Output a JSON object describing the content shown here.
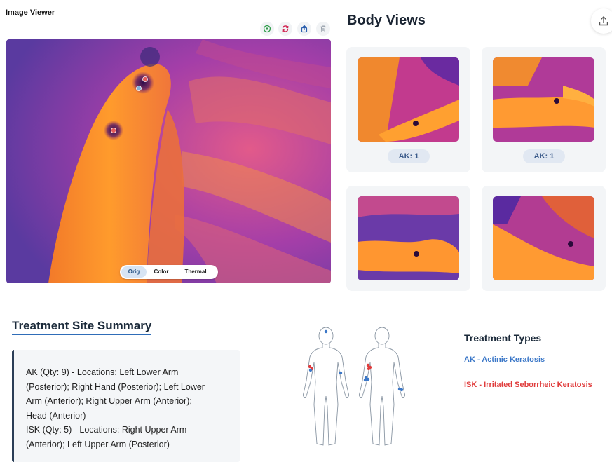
{
  "viewer": {
    "title": "Image Viewer",
    "tools": [
      {
        "icon": "add-circle-icon",
        "color": "#2e9c48"
      },
      {
        "icon": "refresh-icon",
        "color": "#d0204e"
      },
      {
        "icon": "export-icon",
        "color": "#2b5fae"
      },
      {
        "icon": "trash-icon",
        "color": "#9aa3ad"
      }
    ],
    "modes": [
      "Orig",
      "Color",
      "Thermal"
    ],
    "active_mode": "Orig",
    "markers": [
      {
        "color": "#e35a5a"
      },
      {
        "color": "#7fb1d9"
      },
      {
        "color": "#e35a5a"
      }
    ]
  },
  "body_views": {
    "title": "Body Views",
    "share_icon": "upload-icon",
    "cards": [
      {
        "label": "AK: 1"
      },
      {
        "label": "AK: 1"
      },
      {
        "label": ""
      },
      {
        "label": ""
      }
    ]
  },
  "summary": {
    "title": "Treatment Site Summary",
    "lines": [
      "AK (Qty: 9) - Locations: Left Lower Arm",
      "(Posterior); Right Hand (Posterior); Left Lower",
      "Arm (Anterior); Right Upper Arm (Anterior);",
      "Head (Anterior)",
      "ISK (Qty: 5) - Locations: Right Upper Arm",
      "(Anterior); Left Upper Arm (Posterior)"
    ]
  },
  "treatment_types": {
    "title": "Treatment Types",
    "ak": "AK - Actinic Keratosis",
    "isk": "ISK - Irritated Seborrheic Keratosis"
  },
  "colors": {
    "ak": "#3c78c8",
    "isk": "#e03c3c",
    "accent": "#2f6db8"
  }
}
